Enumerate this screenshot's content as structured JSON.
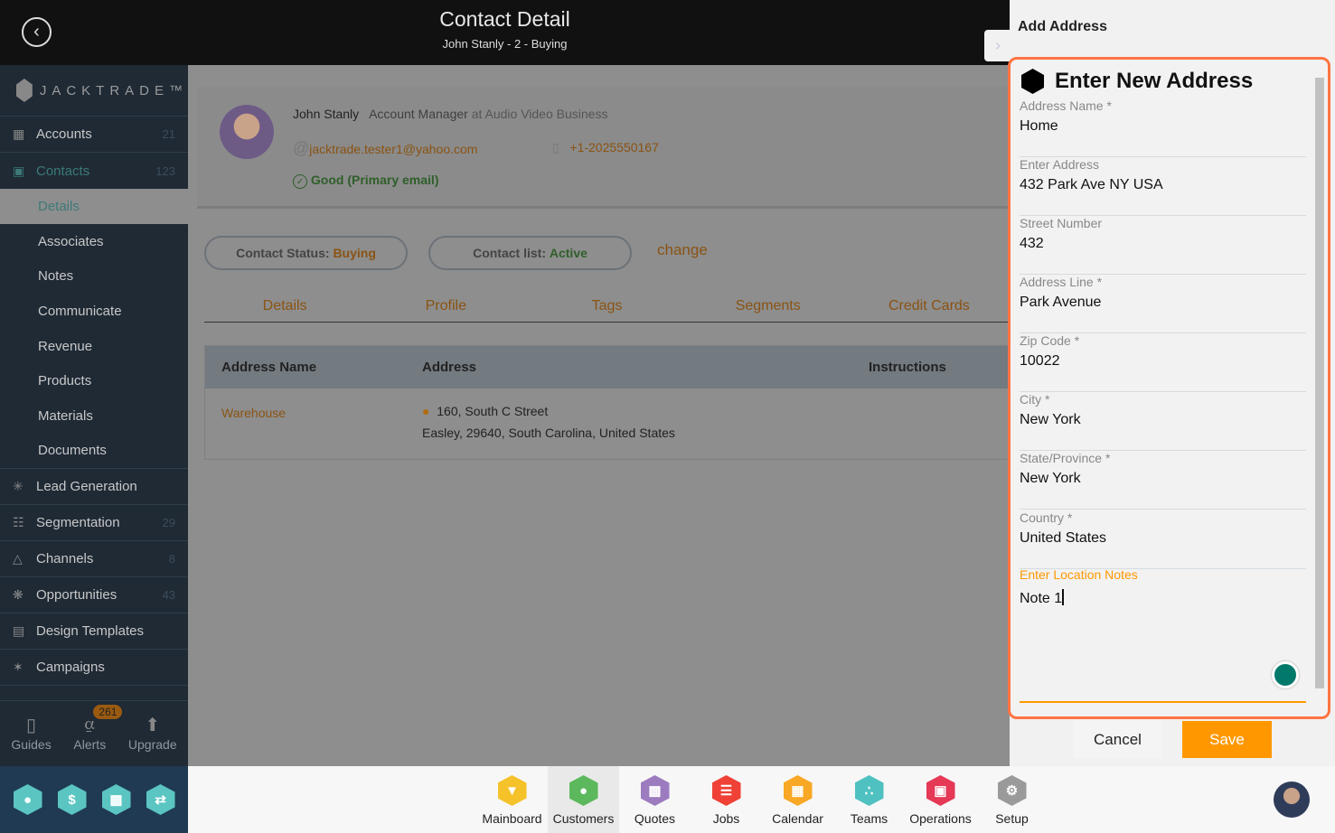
{
  "header": {
    "title": "Contact Detail",
    "subtitle": "John Stanly - 2 - Buying"
  },
  "sidebar": {
    "logo": "JACKTRADE™",
    "items": [
      {
        "label": "Accounts",
        "count": "21",
        "icon": "building-icon"
      },
      {
        "label": "Contacts",
        "count": "123",
        "icon": "contacts-icon"
      }
    ],
    "subitems": [
      "Details",
      "Associates",
      "Notes",
      "Communicate",
      "Revenue",
      "Products",
      "Materials",
      "Documents"
    ],
    "items2": [
      {
        "label": "Lead Generation",
        "count": "",
        "icon": "lead-icon"
      },
      {
        "label": "Segmentation",
        "count": "29",
        "icon": "segmentation-icon"
      },
      {
        "label": "Channels",
        "count": "8",
        "icon": "channels-icon"
      },
      {
        "label": "Opportunities",
        "count": "43",
        "icon": "opportunities-icon"
      },
      {
        "label": "Design Templates",
        "count": "",
        "icon": "templates-icon"
      },
      {
        "label": "Campaigns",
        "count": "",
        "icon": "campaigns-icon"
      }
    ],
    "bottom": {
      "guides": "Guides",
      "alerts": "Alerts",
      "alerts_count": "261",
      "upgrade": "Upgrade"
    }
  },
  "contact": {
    "name": "John Stanly",
    "role": "Account Manager",
    "company_prefix": "at Audio Video Business",
    "email": "jacktrade.tester1@yahoo.com",
    "phone": "+1-2025550167",
    "email_status": "Good (Primary email)",
    "status_label": "Contact Status:",
    "status_value": "Buying",
    "list_label": "Contact list:",
    "list_value": "Active",
    "change": "change"
  },
  "tabs": [
    "Details",
    "Profile",
    "Tags",
    "Segments",
    "Credit Cards"
  ],
  "address_table": {
    "headers": [
      "Address Name",
      "Address",
      "Instructions"
    ],
    "rows": [
      {
        "name": "Wareh­ouse",
        "line1": "160, South C Street",
        "line2": "Easley, 29640, South Carolina, United States",
        "instructions": ""
      }
    ]
  },
  "panel": {
    "title": "Add Address",
    "form_title": "Enter New Address",
    "fields": [
      {
        "label": "Address Name *",
        "value": "Home"
      },
      {
        "label": "Enter Address",
        "value": "432 Park Ave  NY  USA"
      },
      {
        "label": "Street Number",
        "value": "432"
      },
      {
        "label": "Address Line *",
        "value": "Park Avenue"
      },
      {
        "label": "Zip Code *",
        "value": "10022"
      },
      {
        "label": "City *",
        "value": "New York"
      },
      {
        "label": "State/Province *",
        "value": "New York"
      },
      {
        "label": "Country *",
        "value": "United States"
      }
    ],
    "notes_label": "Enter Location Notes",
    "notes_value": "Note 1",
    "cancel": "Cancel",
    "save": "Save"
  },
  "bottom_apps": [
    {
      "label": "Mainboard",
      "color": "#f6c22a"
    },
    {
      "label": "Customers",
      "color": "#5cb85c"
    },
    {
      "label": "Quotes",
      "color": "#9c7bbf"
    },
    {
      "label": "Jobs",
      "color": "#ef4136"
    },
    {
      "label": "Calendar",
      "color": "#f8a825"
    },
    {
      "label": "Teams",
      "color": "#4fc1c0"
    },
    {
      "label": "Operations",
      "color": "#e53956"
    },
    {
      "label": "Setup",
      "color": "#9a9a9a"
    }
  ],
  "colors": {
    "accent": "#ff9800",
    "panel_border": "#ff7443",
    "sidebar": "#1f2a35"
  }
}
